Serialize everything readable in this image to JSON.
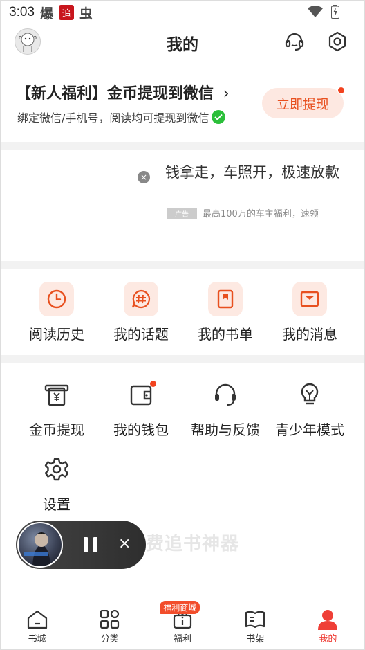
{
  "status_bar": {
    "time": "3:03",
    "app1": "爆",
    "app2": "追",
    "app3": "虫"
  },
  "header": {
    "title": "我的"
  },
  "promo": {
    "title": "【新人福利】金币提现到微信",
    "chevron": "›",
    "subtitle": "绑定微信/手机号，阅读均可提现到微信",
    "button_label": "立即提现"
  },
  "ad": {
    "title": "钱拿走，车照开，极速放款",
    "tag": "广告",
    "description": "最高100万的车主福利，速领",
    "close": "×"
  },
  "quick_actions": [
    {
      "label": "阅读历史",
      "icon": "clock-icon"
    },
    {
      "label": "我的话题",
      "icon": "hashtag-chat-icon"
    },
    {
      "label": "我的书单",
      "icon": "booklist-icon"
    },
    {
      "label": "我的消息",
      "icon": "mail-icon"
    }
  ],
  "services": [
    {
      "label": "金币提现",
      "icon": "coin-withdraw-icon"
    },
    {
      "label": "我的钱包",
      "icon": "wallet-icon"
    },
    {
      "label": "帮助与反馈",
      "icon": "headset-icon"
    },
    {
      "label": "青少年模式",
      "icon": "lightbulb-icon"
    },
    {
      "label": "设置",
      "icon": "gear-icon"
    }
  ],
  "player": {
    "close": "×"
  },
  "watermark": "费追书神器",
  "bottom_nav": [
    {
      "label": "书城",
      "icon": "home-icon",
      "active": false
    },
    {
      "label": "分类",
      "icon": "category-icon",
      "active": false
    },
    {
      "label": "福利",
      "icon": "gift-icon",
      "active": false,
      "badge": "福利商城"
    },
    {
      "label": "书架",
      "icon": "bookshelf-icon",
      "active": false
    },
    {
      "label": "我的",
      "icon": "profile-icon",
      "active": true
    }
  ],
  "colors": {
    "accent": "#ef3f37",
    "tile_bg": "#fde9e2",
    "button_text": "#e8501f"
  }
}
